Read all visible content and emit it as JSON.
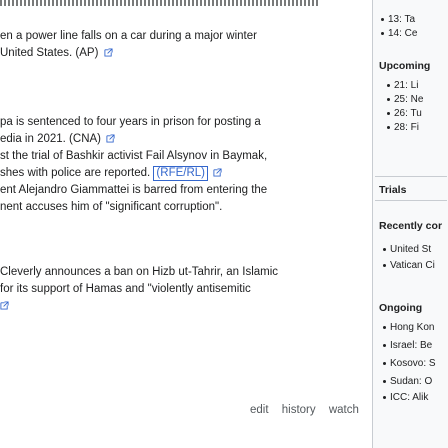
{
  "main": {
    "top_partial": "",
    "paragraphs": [
      {
        "lines": [
          "en a power line falls on a car during a major winter",
          "United States. (AP)"
        ]
      },
      {
        "lines": [
          "pa is sentenced to four years in prison for posting a",
          "edia in 2021. (CNA)",
          "st the trial of Bashkir activist Fail Alsynov in Baymak,",
          "shes with police are reported.",
          "ent Alejandro Giammattei is barred from entering the",
          "nent accuses him of \"significant corruption\"."
        ],
        "ref": "RFE/RL"
      },
      {
        "lines": [
          " Cleverly announces a ban on Hizb ut-Tahrir, an Islamic",
          "for its support of Hamas and \"violently antisemitic"
        ]
      }
    ],
    "edit_links": [
      "edit",
      "history",
      "watch"
    ]
  },
  "sidebar": {
    "top_items": [
      "13: Ta",
      "14: Ce"
    ],
    "upcoming_title": "Upcoming",
    "upcoming_items": [
      "21: Li",
      "25: Ne",
      "26: Tu",
      "28: Fi"
    ],
    "trials_title": "Trials",
    "recent_title": "Recently cor",
    "recent_items": [
      "United St",
      "Vatican Ci"
    ],
    "ongoing_title": "Ongoing",
    "ongoing_items": [
      "Hong Kon",
      "Israel: Be",
      "Kosovo: S",
      "Sudan: O",
      "ICC: Alik"
    ]
  },
  "colors": {
    "link": "#3366cc",
    "sidebar_bg": "#f8f9fa",
    "border": "#c8ccd1"
  }
}
